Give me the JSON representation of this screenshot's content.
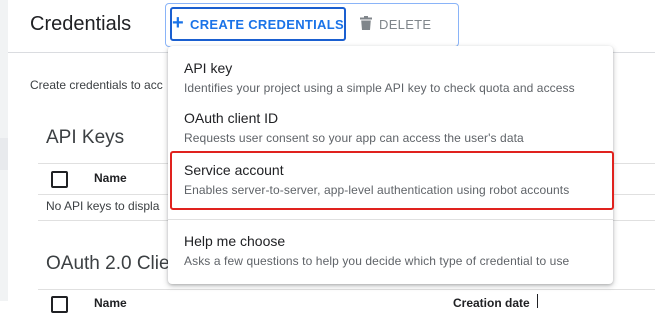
{
  "header": {
    "title": "Credentials",
    "create_label": "CREATE CREDENTIALS",
    "delete_label": "DELETE"
  },
  "main": {
    "intro": "Create credentials to acc",
    "api_keys": {
      "title": "API Keys",
      "col_name": "Name",
      "empty": "No API keys to displa"
    },
    "oauth": {
      "title": "OAuth 2.0 Clie",
      "col_name": "Name",
      "col_date": "Creation date"
    }
  },
  "menu": {
    "items": [
      {
        "title": "API key",
        "desc": "Identifies your project using a simple API key to check quota and access"
      },
      {
        "title": "OAuth client ID",
        "desc": "Requests user consent so your app can access the user's data"
      },
      {
        "title": "Service account",
        "desc": "Enables server-to-server, app-level authentication using robot accounts"
      },
      {
        "title": "Help me choose",
        "desc": "Asks a few questions to help you decide which type of credential to use"
      }
    ]
  },
  "icons": {
    "create": "plus-icon",
    "delete": "trash-icon"
  },
  "colors": {
    "accent": "#1a73e8",
    "highlight": "#e0221e"
  }
}
